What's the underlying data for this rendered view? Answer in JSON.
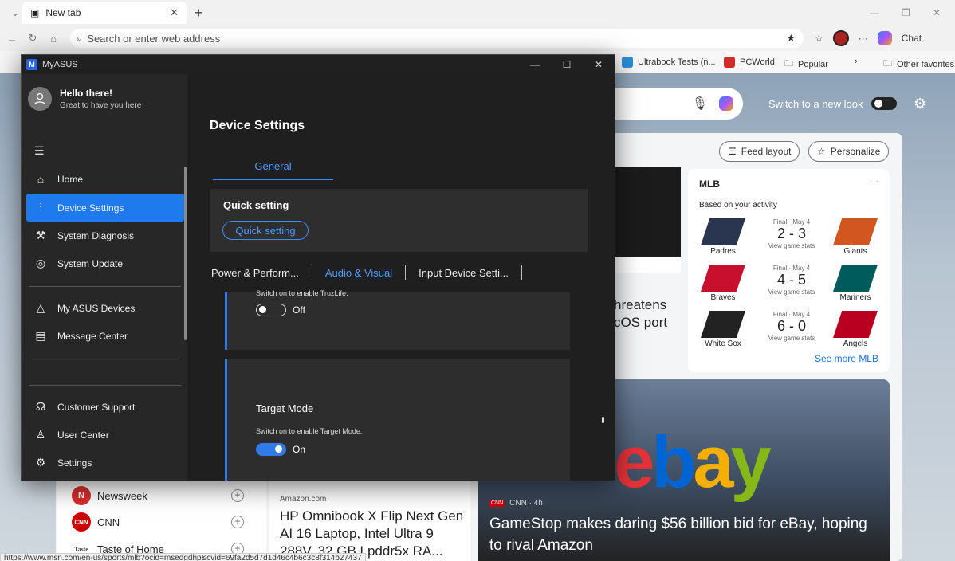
{
  "browser": {
    "tab_title": "New tab",
    "tab_close": "✕",
    "new_tab": "+",
    "address_placeholder": "Search or enter web address",
    "chat_label": "Chat",
    "favorites": [
      {
        "label": "Ultrabook Tests (n...",
        "color": "#2b8fd6"
      },
      {
        "label": "PCWorld",
        "color": "#d12b2b"
      },
      {
        "label": "Popular",
        "color": "#ffffff"
      },
      {
        "label": "Other favorites",
        "color": "#ffffff"
      }
    ],
    "status_url": "https://www.msn.com/en-us/sports/mlb?ocid=msedgdhp&cvid=69fa2d5d7d1d46c4b6c3c8f314b27437"
  },
  "msn": {
    "switch_look": "Switch to a new look",
    "feed_layout": "Feed layout",
    "personalize": "Personalize",
    "headline_partial": "hreatens\ncOS port",
    "mlb": {
      "title": "MLB",
      "subtitle": "Based on your activity",
      "games": [
        {
          "home": "Padres",
          "away": "Giants",
          "status": "Final · May 4",
          "score": "2 - 3",
          "link": "View game stats"
        },
        {
          "home": "Braves",
          "away": "Mariners",
          "status": "Final · May 4",
          "score": "4 - 5",
          "link": "View game stats"
        },
        {
          "home": "White Sox",
          "away": "Angels",
          "status": "Final · May 4",
          "score": "6 - 0",
          "link": "View game stats"
        }
      ],
      "see_more": "See more MLB"
    },
    "sources": [
      {
        "name": "Newsweek",
        "icon": "N",
        "color": "#d72e2e"
      },
      {
        "name": "CNN",
        "icon": "CNN",
        "color": "#cc0000"
      },
      {
        "name": "Taste of Home",
        "icon": "Taste",
        "color": "#ffffff"
      }
    ],
    "amazon": {
      "source": "Amazon.com",
      "title": "HP Omnibook X Flip Next Gen AI 16 Laptop, Intel Ultra 9 288V, 32 GB Lpddr5x RA..."
    },
    "ebay": {
      "logo": "ebay",
      "source": "CNN · 4h",
      "title": "GameStop makes daring $56 billion bid for eBay, hoping to rival Amazon"
    }
  },
  "myasus": {
    "app_title": "MyASUS",
    "user": {
      "greeting": "Hello there!",
      "subtitle": "Great to have you here"
    },
    "nav": [
      {
        "label": "Home",
        "icon": "⌂",
        "active": false
      },
      {
        "label": "Device Settings",
        "icon": "⫶",
        "active": true
      },
      {
        "label": "System Diagnosis",
        "icon": "⚒",
        "active": false
      },
      {
        "label": "System Update",
        "icon": "◎",
        "active": false
      },
      {
        "label": "My ASUS Devices",
        "icon": "△",
        "active": false
      },
      {
        "label": "Message Center",
        "icon": "▤",
        "active": false
      },
      {
        "label": "Customer Support",
        "icon": "☊",
        "active": false
      },
      {
        "label": "User Center",
        "icon": "♙",
        "active": false
      },
      {
        "label": "Settings",
        "icon": "⚙",
        "active": false
      }
    ],
    "page_title": "Device Settings",
    "general_tab": "General",
    "quick_setting_title": "Quick setting",
    "quick_setting_button": "Quick setting",
    "subtabs": [
      "Power & Perform...",
      "Audio & Visual",
      "Input Device Setti..."
    ],
    "truzlife": {
      "sub": "Switch on to enable TruzLife.",
      "state": "Off"
    },
    "target_mode": {
      "title": "Target Mode",
      "sub": "Switch on to enable Target Mode.",
      "state": "On"
    }
  }
}
